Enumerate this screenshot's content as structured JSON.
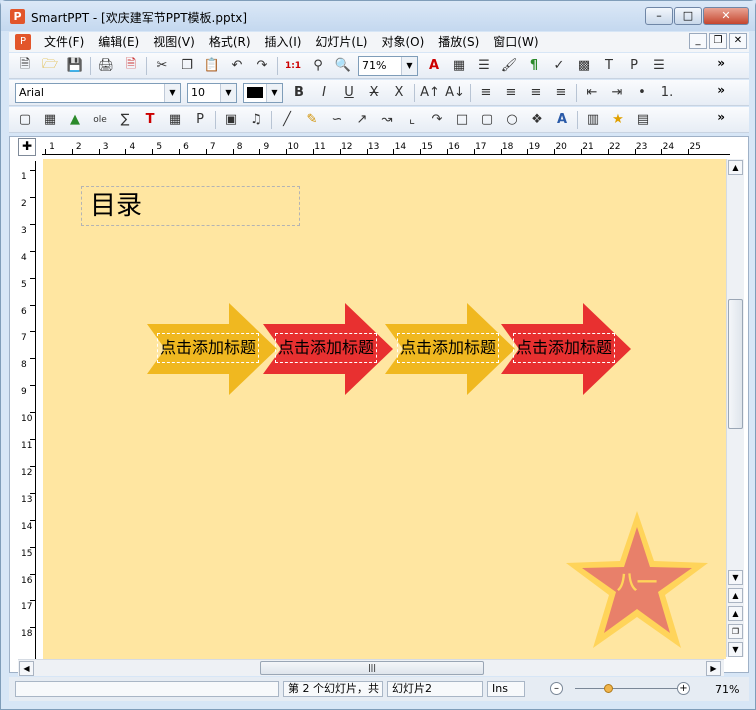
{
  "window": {
    "title": "SmartPPT - [欢庆建军节PPT模板.pptx]",
    "app_icon_letter": "P",
    "buttons": [
      "minimize",
      "maximize",
      "close"
    ]
  },
  "menubar": {
    "items": [
      "文件(F)",
      "编辑(E)",
      "视图(V)",
      "格式(R)",
      "插入(I)",
      "幻灯片(L)",
      "对象(O)",
      "播放(S)",
      "窗口(W)"
    ]
  },
  "toolbar1": {
    "zoom_value": "71%",
    "more": "»"
  },
  "toolbar2": {
    "font_family": "Arial",
    "font_size": "10",
    "font_color": "#000000",
    "more": "»"
  },
  "toolbar3": {
    "more": "»"
  },
  "ruler": {
    "h_numbers": [
      "1",
      "2",
      "3",
      "4",
      "5",
      "6",
      "7",
      "8",
      "9",
      "10",
      "11",
      "12",
      "13",
      "14",
      "15",
      "16",
      "17",
      "18",
      "19",
      "20",
      "21",
      "22",
      "23",
      "24",
      "25"
    ],
    "v_numbers": [
      "1",
      "2",
      "3",
      "4",
      "5",
      "6",
      "7",
      "8",
      "9",
      "10",
      "11",
      "12",
      "13",
      "14",
      "15",
      "16",
      "17",
      "18"
    ]
  },
  "slide": {
    "background": "#ffe6a1",
    "title": "目录",
    "arrows": [
      {
        "label": "点击添加标题",
        "color": "#f0b820"
      },
      {
        "label": "点击添加标题",
        "color": "#e83030"
      },
      {
        "label": "点击添加标题",
        "color": "#f0b820"
      },
      {
        "label": "点击添加标题",
        "color": "#e83030"
      }
    ],
    "star_text": "八一",
    "star_colors": {
      "outer": "#ffd45a",
      "inner": "#e8806a"
    }
  },
  "statusbar": {
    "cell1": "",
    "slide_info": "第 2 个幻灯片，共",
    "slide_name": "幻灯片2",
    "mode": "Ins",
    "zoom": "71%"
  }
}
